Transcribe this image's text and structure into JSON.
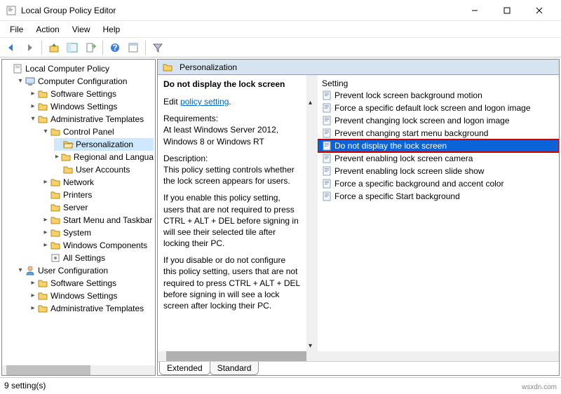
{
  "window": {
    "title": "Local Group Policy Editor"
  },
  "menu": {
    "file": "File",
    "action": "Action",
    "view": "View",
    "help": "Help"
  },
  "tree": {
    "root": "Local Computer Policy",
    "computer_config": "Computer Configuration",
    "software_settings": "Software Settings",
    "windows_settings": "Windows Settings",
    "admin_templates": "Administrative Templates",
    "control_panel": "Control Panel",
    "personalization": "Personalization",
    "regional": "Regional and Langua",
    "user_accounts": "User Accounts",
    "network": "Network",
    "printers": "Printers",
    "server": "Server",
    "start_taskbar": "Start Menu and Taskbar",
    "system": "System",
    "win_components": "Windows Components",
    "all_settings": "All Settings",
    "user_config": "User Configuration",
    "u_software": "Software Settings",
    "u_windows": "Windows Settings",
    "u_admin": "Administrative Templates"
  },
  "crumb": {
    "label": "Personalization"
  },
  "desc": {
    "title": "Do not display the lock screen",
    "edit_prefix": "Edit",
    "edit_link": "policy setting",
    "req_label": "Requirements:",
    "req_text": "At least Windows Server 2012, Windows 8 or Windows RT",
    "desc_label": "Description:",
    "desc_text1": "This policy setting controls whether the lock screen appears for users.",
    "desc_text2": "If you enable this policy setting, users that are not required to press CTRL + ALT + DEL before signing in will see their selected tile after locking their PC.",
    "desc_text3": "If you disable or do not configure this policy setting, users that are not required to press CTRL + ALT + DEL before signing in will see a lock screen after locking their PC."
  },
  "list": {
    "header": "Setting",
    "items": [
      "Prevent lock screen background motion",
      "Force a specific default lock screen and logon image",
      "Prevent changing lock screen and logon image",
      "Prevent changing start menu background",
      "Do not display the lock screen",
      "Prevent enabling lock screen camera",
      "Prevent enabling lock screen slide show",
      "Force a specific background and accent color",
      "Force a specific Start background"
    ]
  },
  "tabs": {
    "extended": "Extended",
    "standard": "Standard"
  },
  "status": {
    "text": "9 setting(s)"
  },
  "watermark": "wsxdn.com"
}
